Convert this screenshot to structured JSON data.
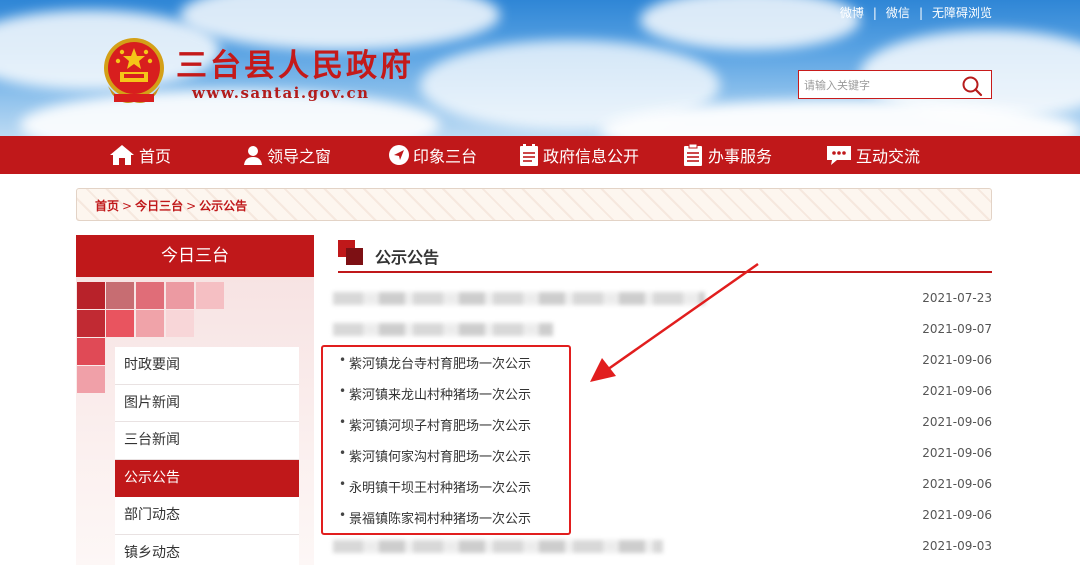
{
  "header": {
    "site_title": "三台县人民政府",
    "site_url": "www.santai.gov.cn",
    "top_links": [
      "微博",
      "微信",
      "无障碍浏览"
    ],
    "top_link_separator": "|",
    "search": {
      "placeholder": "请输入关键字"
    }
  },
  "nav": {
    "items": [
      {
        "label": "首页",
        "icon": "home-icon"
      },
      {
        "label": "领导之窗",
        "icon": "person-icon"
      },
      {
        "label": "印象三台",
        "icon": "navigation-icon"
      },
      {
        "label": "政府信息公开",
        "icon": "document-icon"
      },
      {
        "label": "办事服务",
        "icon": "clipboard-icon"
      },
      {
        "label": "互动交流",
        "icon": "chat-icon"
      }
    ]
  },
  "breadcrumb": {
    "items": [
      "首页",
      "今日三台",
      "公示公告"
    ],
    "separator": ">"
  },
  "sidebar": {
    "title": "今日三台",
    "items": [
      "时政要闻",
      "图片新闻",
      "三台新闻",
      "公示公告",
      "部门动态",
      "镇乡动态"
    ],
    "active_index": 3
  },
  "content": {
    "title": "公示公告",
    "bullet": "•",
    "rows": [
      {
        "title": "",
        "date": "2021-07-23",
        "blurred": true
      },
      {
        "title": "",
        "date": "2021-09-07",
        "blurred": true
      },
      {
        "title": "紫河镇龙台寺村育肥场一次公示",
        "date": "2021-09-06",
        "blurred": false
      },
      {
        "title": "紫河镇来龙山村种猪场一次公示",
        "date": "2021-09-06",
        "blurred": false
      },
      {
        "title": "紫河镇河坝子村育肥场一次公示",
        "date": "2021-09-06",
        "blurred": false
      },
      {
        "title": "紫河镇何家沟村育肥场一次公示",
        "date": "2021-09-06",
        "blurred": false
      },
      {
        "title": "永明镇干坝王村种猪场一次公示",
        "date": "2021-09-06",
        "blurred": false
      },
      {
        "title": "景福镇陈家祠村种猪场一次公示",
        "date": "2021-09-06",
        "blurred": false
      },
      {
        "title": "",
        "date": "2021-09-03",
        "blurred": true
      }
    ]
  },
  "colors": {
    "brand_red": "#c0181a",
    "annotation_red": "#e11e1e"
  }
}
